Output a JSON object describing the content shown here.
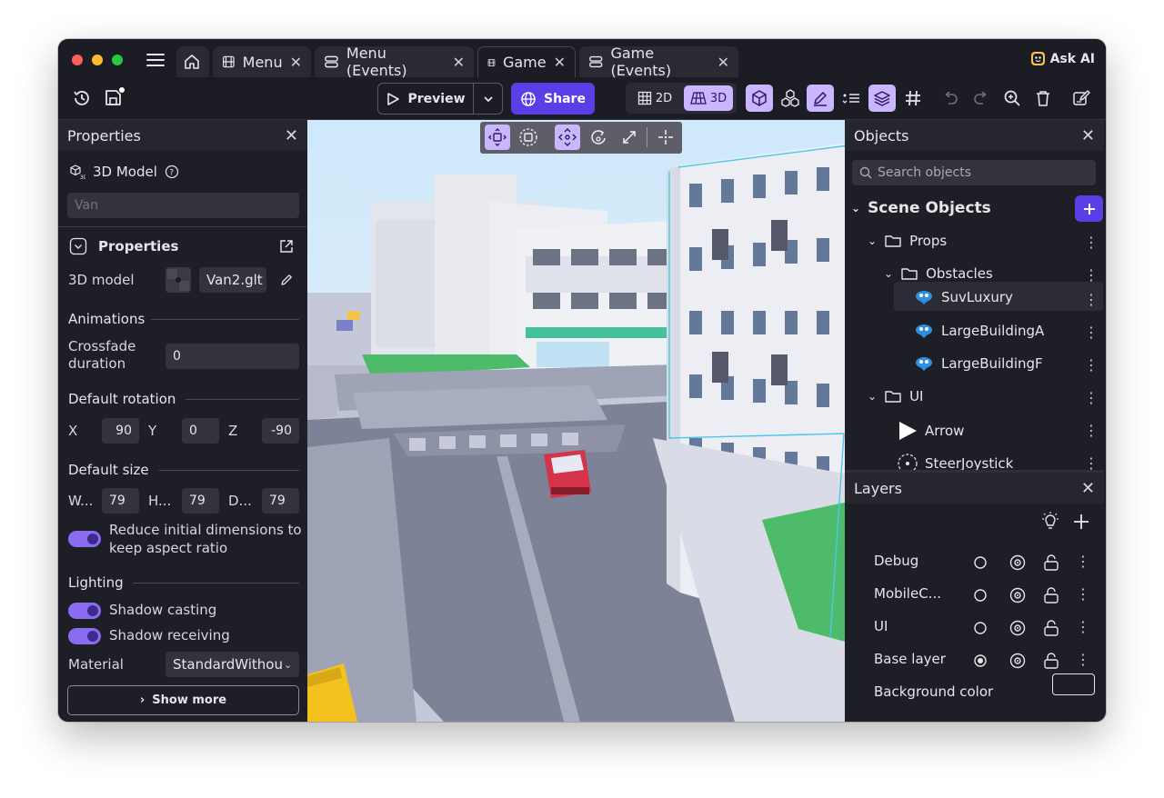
{
  "tabs": [
    {
      "label": "Menu",
      "active": false
    },
    {
      "label": "Menu (Events)",
      "active": false
    },
    {
      "label": "Game",
      "active": true
    },
    {
      "label": "Game (Events)",
      "active": false
    }
  ],
  "ask_ai": "Ask AI",
  "toolbar": {
    "preview_label": "Preview",
    "share_label": "Share",
    "mode_2d": "2D",
    "mode_3d": "3D"
  },
  "properties": {
    "title": "Properties",
    "object_type": "3D Model",
    "name_placeholder": "Van",
    "section_title": "Properties",
    "model_label": "3D model",
    "model_value": "Van2.glt",
    "animations": "Animations",
    "crossfade_label_1": "Crossfade",
    "crossfade_label_2": "duration",
    "crossfade_value": "0",
    "default_rotation": "Default rotation",
    "rotation": {
      "x_label": "X",
      "x": "90",
      "y_label": "Y",
      "y": "0",
      "z_label": "Z",
      "z": "-90"
    },
    "default_size": "Default size",
    "size": {
      "w_label": "W...",
      "w": "79",
      "h_label": "H...",
      "h": "79",
      "d_label": "D...",
      "d": "79"
    },
    "aspect_line_1": "Reduce initial dimensions to",
    "aspect_line_2": "keep aspect ratio",
    "lighting": "Lighting",
    "shadow_casting": "Shadow casting",
    "shadow_receiving": "Shadow receiving",
    "material_label": "Material",
    "material_value": "StandardWithou",
    "show_more": "Show more"
  },
  "objects": {
    "title": "Objects",
    "search_placeholder": "Search objects",
    "scene_objects": "Scene Objects",
    "items": [
      {
        "label": "Props"
      },
      {
        "label": "Obstacles"
      },
      {
        "label": "SuvLuxury"
      },
      {
        "label": "LargeBuildingA"
      },
      {
        "label": "LargeBuildingF"
      },
      {
        "label": "UI"
      },
      {
        "label": "Arrow"
      },
      {
        "label": "SteerJoystick"
      }
    ]
  },
  "layers": {
    "title": "Layers",
    "rows": [
      {
        "label": "Debug",
        "selected": false
      },
      {
        "label": "MobileC...",
        "selected": false
      },
      {
        "label": "UI",
        "selected": false
      },
      {
        "label": "Base layer",
        "selected": true
      }
    ],
    "background_color_label": "Background color",
    "background_color": "#1e1e26"
  },
  "colors": {
    "accent": "#5b3ee6",
    "accent_light": "#c9b6ff",
    "toggle": "#8a6cf0"
  }
}
